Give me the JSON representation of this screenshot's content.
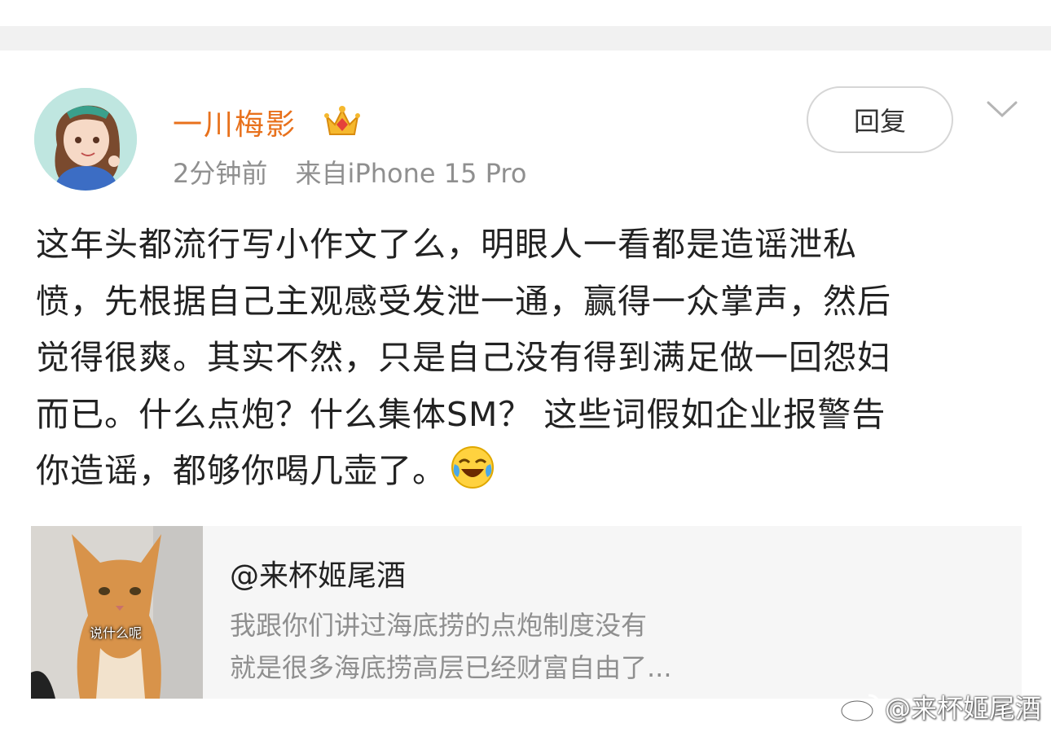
{
  "post": {
    "username": "一川梅影",
    "time": "2分钟前",
    "source": "来自iPhone 15 Pro",
    "reply_label": "回复",
    "text_lines": [
      "这年头都流行写小作文了么，明眼人一看都是造谣泄私",
      "愤，先根据自己主观感受发泄一通，赢得一众掌声，然后",
      "觉得很爽。其实不然，只是自己没有得到满足做一回怨妇",
      "而已。什么点炮？什么集体SM？ 这些词假如企业报警告",
      "你造谣，都够你喝几壶了。"
    ],
    "emoji": "laughing-crying-icon"
  },
  "quote": {
    "author": "@来杯姬尾酒",
    "thumb_caption": "说什么呢",
    "excerpt_lines": [
      "我跟你们讲过海底捞的点炮制度没有",
      "就是很多海底捞高层已经财富自由了..."
    ]
  },
  "watermark": {
    "text": "@来杯姬尾酒"
  },
  "colors": {
    "username": "#e8711c",
    "meta": "#8f8f8f",
    "body_text": "#222222",
    "quote_bg": "#f6f6f6"
  }
}
